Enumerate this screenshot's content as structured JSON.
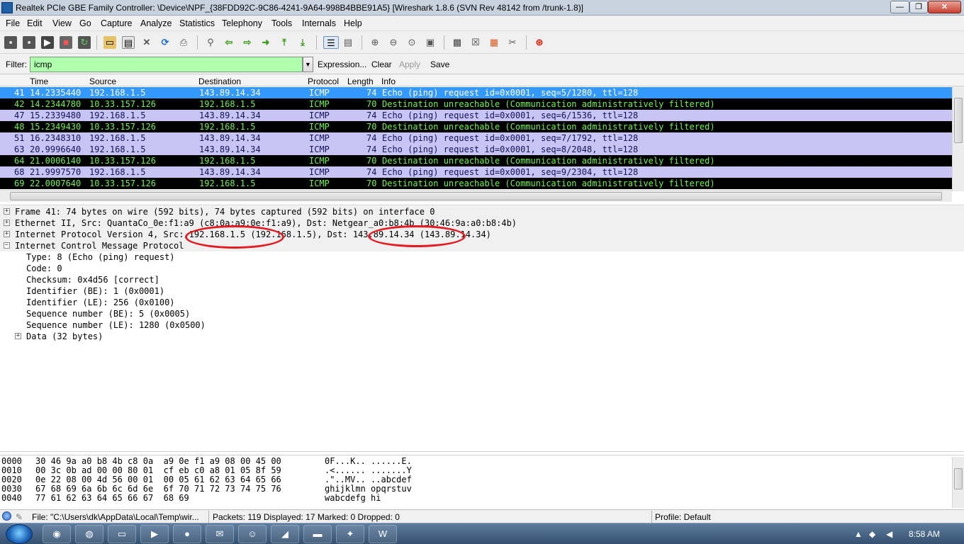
{
  "window": {
    "title": "Realtek PCIe GBE Family Controller: \\Device\\NPF_{38FDD92C-9C86-4241-9A64-998B4BBE91A5}   [Wireshark 1.8.6  (SVN Rev 48142 from /trunk-1.8)]",
    "buttons": {
      "minimize": "—",
      "maximize": "❐",
      "close": "✕"
    }
  },
  "menu": [
    "File",
    "Edit",
    "View",
    "Go",
    "Capture",
    "Analyze",
    "Statistics",
    "Telephony",
    "Tools",
    "Internals",
    "Help"
  ],
  "toolbar": {
    "icons": [
      "interfaces-icon",
      "options-icon",
      "start-capture-icon",
      "stop-capture-icon",
      "restart-capture-icon",
      "open-file-icon",
      "save-file-icon",
      "close-file-icon",
      "reload-icon",
      "print-icon",
      "find-icon",
      "back-icon",
      "forward-icon",
      "go-to-packet-icon",
      "first-packet-icon",
      "last-packet-icon",
      "colorize-icon",
      "autoscroll-icon",
      "zoom-in-icon",
      "zoom-out-icon",
      "zoom-normal-icon",
      "resize-columns-icon",
      "capture-filters-icon",
      "display-filters-icon",
      "coloring-rules-icon",
      "preferences-icon",
      "help-icon"
    ]
  },
  "filter": {
    "label": "Filter:",
    "value": "icmp",
    "expression": "Expression...",
    "clear": "Clear",
    "apply": "Apply",
    "save": "Save",
    "bg_color": "#afffaf"
  },
  "packet_list": {
    "columns": [
      "Time",
      "Source",
      "Destination",
      "Protocol",
      "Length",
      "Info"
    ],
    "rows": [
      {
        "no": "41",
        "time": "14.2335440",
        "src": "192.168.1.5",
        "dst": "143.89.14.34",
        "proto": "ICMP",
        "len": "74",
        "info": "Echo (ping) request  id=0x0001, seq=5/1280, ttl=128",
        "kind": "selected"
      },
      {
        "no": "42",
        "time": "14.2344780",
        "src": "10.33.157.126",
        "dst": "192.168.1.5",
        "proto": "ICMP",
        "len": "70",
        "info": "Destination unreachable (Communication administratively filtered)",
        "kind": "unreachable"
      },
      {
        "no": "47",
        "time": "15.2339480",
        "src": "192.168.1.5",
        "dst": "143.89.14.34",
        "proto": "ICMP",
        "len": "74",
        "info": "Echo (ping) request  id=0x0001, seq=6/1536, ttl=128",
        "kind": "echo"
      },
      {
        "no": "48",
        "time": "15.2349430",
        "src": "10.33.157.126",
        "dst": "192.168.1.5",
        "proto": "ICMP",
        "len": "70",
        "info": "Destination unreachable (Communication administratively filtered)",
        "kind": "unreachable"
      },
      {
        "no": "51",
        "time": "16.2348310",
        "src": "192.168.1.5",
        "dst": "143.89.14.34",
        "proto": "ICMP",
        "len": "74",
        "info": "Echo (ping) request  id=0x0001, seq=7/1792, ttl=128",
        "kind": "echo"
      },
      {
        "no": "63",
        "time": "20.9996640",
        "src": "192.168.1.5",
        "dst": "143.89.14.34",
        "proto": "ICMP",
        "len": "74",
        "info": "Echo (ping) request  id=0x0001, seq=8/2048, ttl=128",
        "kind": "echo"
      },
      {
        "no": "64",
        "time": "21.0006140",
        "src": "10.33.157.126",
        "dst": "192.168.1.5",
        "proto": "ICMP",
        "len": "70",
        "info": "Destination unreachable (Communication administratively filtered)",
        "kind": "unreachable"
      },
      {
        "no": "68",
        "time": "21.9997570",
        "src": "192.168.1.5",
        "dst": "143.89.14.34",
        "proto": "ICMP",
        "len": "74",
        "info": "Echo (ping) request  id=0x0001, seq=9/2304, ttl=128",
        "kind": "echo"
      },
      {
        "no": "69",
        "time": "22.0007640",
        "src": "10.33.157.126",
        "dst": "192.168.1.5",
        "proto": "ICMP",
        "len": "70",
        "info": "Destination unreachable (Communication administratively filtered)",
        "kind": "unreachable"
      }
    ],
    "colors": {
      "selected": "#3399ff",
      "echo": "#c8c4f4",
      "unreachable": "#000000",
      "unreachable_text": "#72f04f"
    }
  },
  "details": [
    {
      "text": "Frame 41: 74 bytes on wire (592 bits), 74 bytes captured (592 bits) on interface 0",
      "level": 0,
      "expander": "+"
    },
    {
      "text": "Ethernet II, Src: QuantaCo_0e:f1:a9 (c8:0a:a9:0e:f1:a9), Dst: Netgear_a0:b8:4b (30:46:9a:a0:b8:4b)",
      "level": 0,
      "expander": "+"
    },
    {
      "text": "Internet Protocol Version 4, Src: 192.168.1.5 (192.168.1.5), Dst: 143.89.14.34 (143.89.14.34)",
      "level": 0,
      "expander": "+"
    },
    {
      "text": "Internet Control Message Protocol",
      "level": 0,
      "expander": "−"
    },
    {
      "text": "Type: 8 (Echo (ping) request)",
      "level": 1,
      "expander": ""
    },
    {
      "text": "Code: 0",
      "level": 1,
      "expander": ""
    },
    {
      "text": "Checksum: 0x4d56 [correct]",
      "level": 1,
      "expander": ""
    },
    {
      "text": "Identifier (BE): 1 (0x0001)",
      "level": 1,
      "expander": ""
    },
    {
      "text": "Identifier (LE): 256 (0x0100)",
      "level": 1,
      "expander": ""
    },
    {
      "text": "Sequence number (BE): 5 (0x0005)",
      "level": 1,
      "expander": ""
    },
    {
      "text": "Sequence number (LE): 1280 (0x0500)",
      "level": 1,
      "expander": ""
    },
    {
      "text": "Data (32 bytes)",
      "level": 1,
      "expander": "+"
    }
  ],
  "hex": [
    {
      "offset": "0000",
      "bytes": "30 46 9a a0 b8 4b c8 0a  a9 0e f1 a9 08 00 45 00",
      "ascii": "0F...K.. ......E."
    },
    {
      "offset": "0010",
      "bytes": "00 3c 0b ad 00 00 80 01  cf eb c0 a8 01 05 8f 59",
      "ascii": ".<...... .......Y"
    },
    {
      "offset": "0020",
      "bytes": "0e 22 08 00 4d 56 00 01  00 05 61 62 63 64 65 66",
      "ascii": ".\"..MV.. ..abcdef"
    },
    {
      "offset": "0030",
      "bytes": "67 68 69 6a 6b 6c 6d 6e  6f 70 71 72 73 74 75 76",
      "ascii": "ghijklmn opqrstuv"
    },
    {
      "offset": "0040",
      "bytes": "77 61 62 63 64 65 66 67  68 69",
      "ascii": "wabcdefg hi"
    }
  ],
  "status": {
    "file": "File: \"C:\\Users\\dk\\AppData\\Local\\Temp\\wir...",
    "packets": "Packets: 119 Displayed: 17 Marked: 0 Dropped: 0",
    "profile": "Profile: Default"
  },
  "taskbar": {
    "apps": [
      "chrome-icon",
      "firefox-icon",
      "explorer-icon",
      "media-player-icon",
      "github-icon",
      "outlook-icon",
      "messenger-icon",
      "wireshark-icon",
      "cmd-icon",
      "acrobat-icon",
      "word-icon"
    ],
    "clock": "8:58 AM"
  }
}
